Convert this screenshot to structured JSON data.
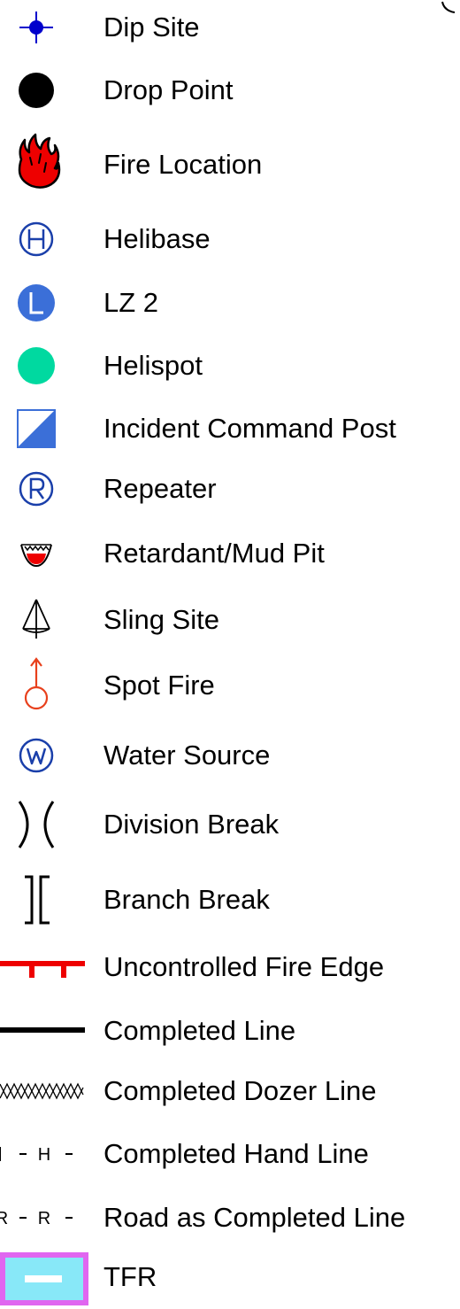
{
  "legend": {
    "items": [
      {
        "label": "Dip Site",
        "icon": "dip-site-icon",
        "color": "#0000cc"
      },
      {
        "label": "Drop Point",
        "icon": "drop-point-icon",
        "color": "#000000"
      },
      {
        "label": "Fire Location",
        "icon": "flame-icon",
        "color": "#ee0000"
      },
      {
        "label": "Helibase",
        "icon": "helibase-icon",
        "color": "#1a3faa"
      },
      {
        "label": "LZ 2",
        "icon": "landing-zone-icon",
        "color": "#3b6fd8"
      },
      {
        "label": "Helispot",
        "icon": "helispot-icon",
        "color": "#00d9a0"
      },
      {
        "label": "Incident Command Post",
        "icon": "command-post-icon",
        "color": "#3b6fd8"
      },
      {
        "label": "Repeater",
        "icon": "repeater-icon",
        "color": "#1a3faa"
      },
      {
        "label": "Retardant/Mud Pit",
        "icon": "retardant-pit-icon",
        "color": "#ee0000"
      },
      {
        "label": "Sling Site",
        "icon": "sling-site-icon",
        "color": "#000000"
      },
      {
        "label": "Spot Fire",
        "icon": "spot-fire-icon",
        "color": "#e8401c"
      },
      {
        "label": "Water Source",
        "icon": "water-source-icon",
        "color": "#1a3faa"
      },
      {
        "label": "Division Break",
        "icon": "division-break-icon",
        "color": "#000000"
      },
      {
        "label": "Branch Break",
        "icon": "branch-break-icon",
        "color": "#000000"
      },
      {
        "label": "Uncontrolled Fire Edge",
        "icon": "uncontrolled-fire-edge-icon",
        "color": "#ee0000"
      },
      {
        "label": "Completed Line",
        "icon": "completed-line-icon",
        "color": "#000000"
      },
      {
        "label": "Completed Dozer Line",
        "icon": "dozer-line-icon",
        "color": "#000000"
      },
      {
        "label": "Completed Hand Line",
        "icon": "hand-line-icon",
        "color": "#000000",
        "glyph": "H"
      },
      {
        "label": "Road as Completed Line",
        "icon": "road-line-icon",
        "color": "#000000",
        "glyph": "R"
      },
      {
        "label": "TFR",
        "icon": "tfr-icon",
        "color": "#88e8f8"
      }
    ]
  }
}
